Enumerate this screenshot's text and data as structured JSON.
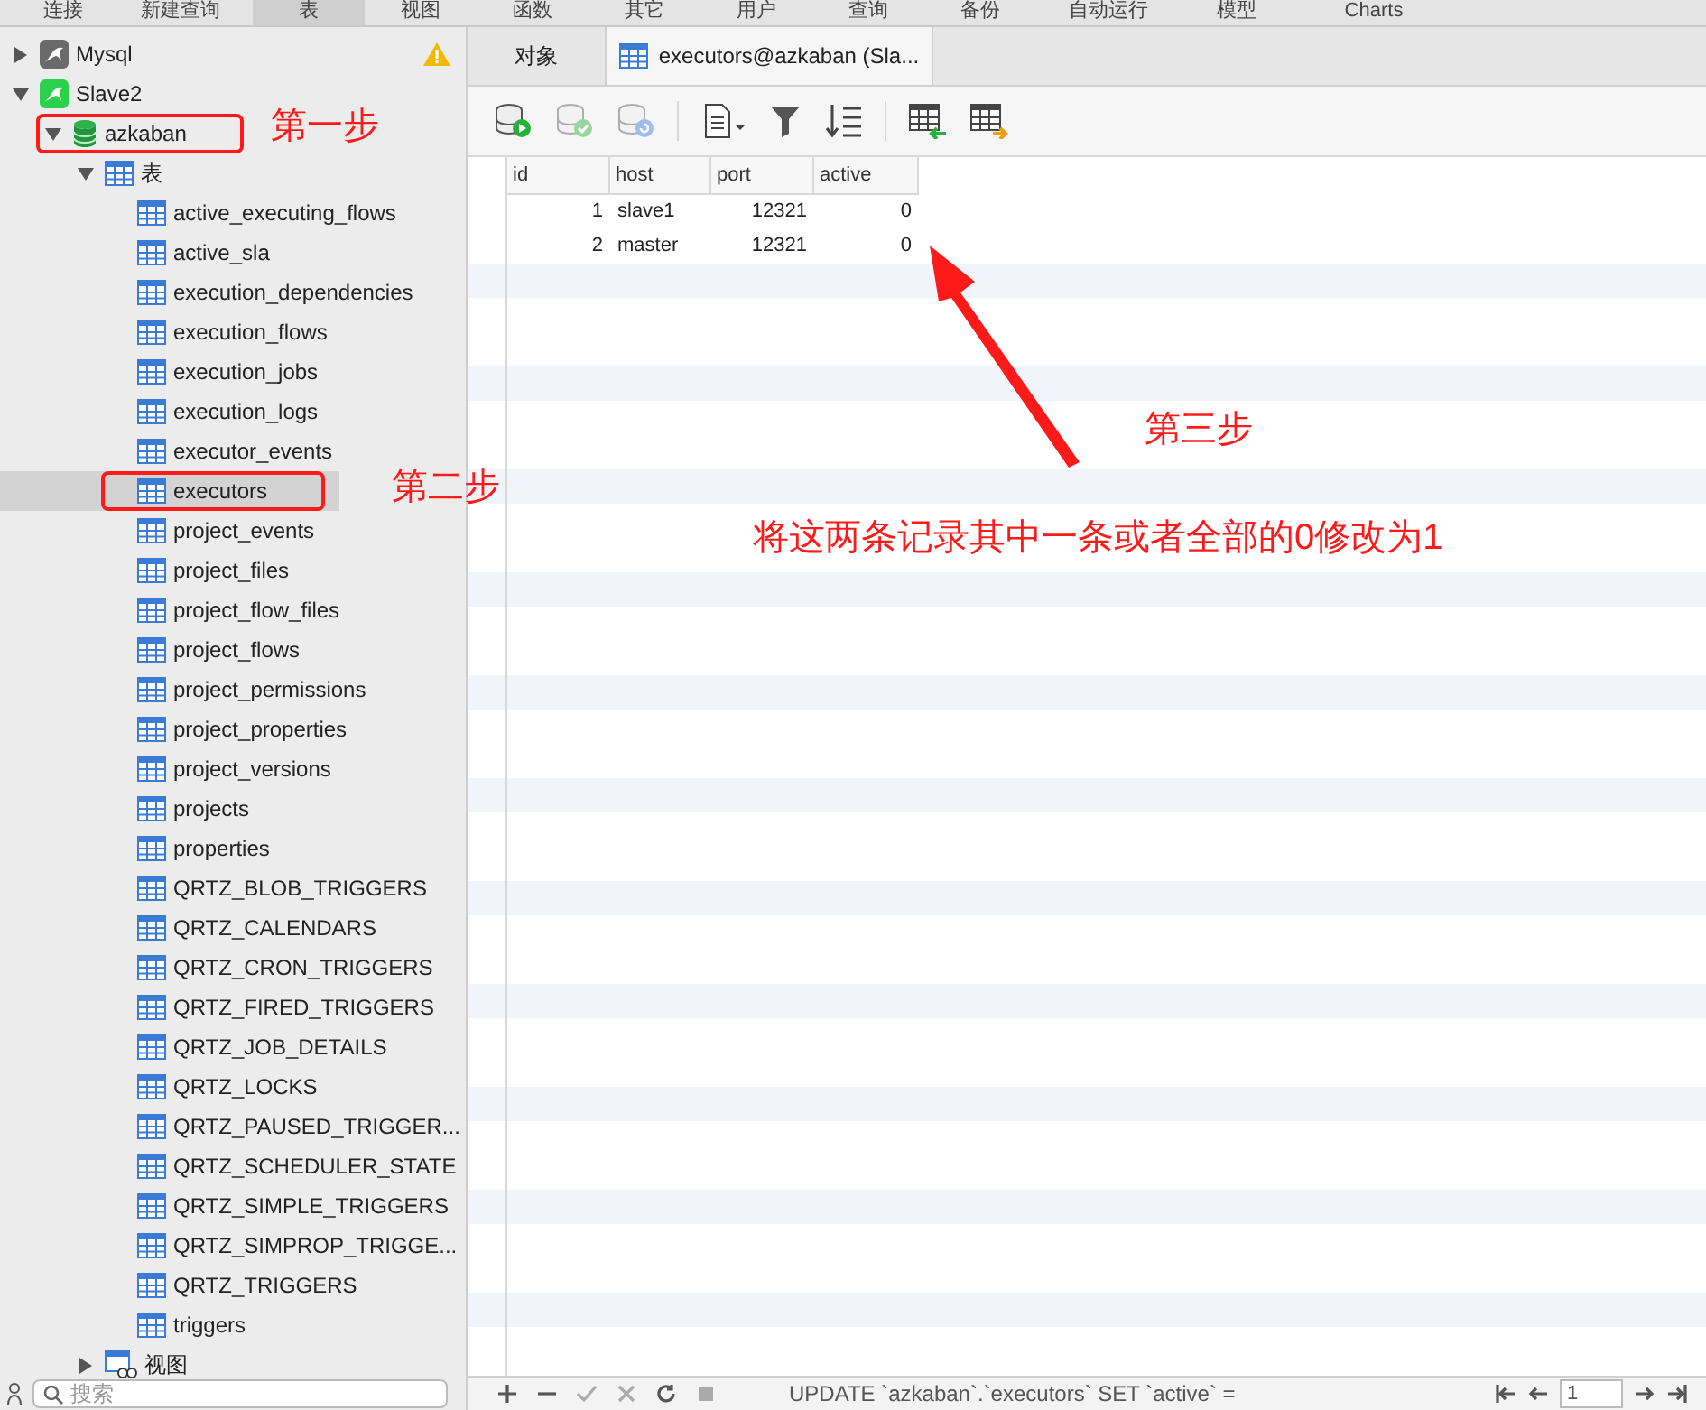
{
  "menu_bar": [
    {
      "label": "连接",
      "selected": false
    },
    {
      "label": "新建查询",
      "selected": false
    },
    {
      "label": "表",
      "selected": true
    },
    {
      "label": "视图",
      "selected": false
    },
    {
      "label": "函数",
      "selected": false
    },
    {
      "label": "其它",
      "selected": false
    },
    {
      "label": "用户",
      "selected": false
    },
    {
      "label": "查询",
      "selected": false
    },
    {
      "label": "备份",
      "selected": false
    },
    {
      "label": "自动运行",
      "selected": false
    },
    {
      "label": "模型",
      "selected": false
    },
    {
      "label": "Charts",
      "selected": false
    }
  ],
  "sidebar": {
    "tree": [
      {
        "kind": "connection",
        "name": "Mysql",
        "warning": true,
        "expanded": false,
        "selected": false,
        "circled": false
      },
      {
        "kind": "connection",
        "name": "Slave2",
        "warning": false,
        "expanded": true,
        "selected": false,
        "circled": false,
        "children": [
          {
            "kind": "database",
            "name": "azkaban",
            "expanded": true,
            "selected": false,
            "circled": true,
            "children": [
              {
                "kind": "tables",
                "name": "表",
                "expanded": true,
                "selected": false,
                "circled": false,
                "children": [
                  {
                    "kind": "table",
                    "name": "active_executing_flows",
                    "selected": false,
                    "circled": false
                  },
                  {
                    "kind": "table",
                    "name": "active_sla",
                    "selected": false,
                    "circled": false
                  },
                  {
                    "kind": "table",
                    "name": "execution_dependencies",
                    "selected": false,
                    "circled": false
                  },
                  {
                    "kind": "table",
                    "name": "execution_flows",
                    "selected": false,
                    "circled": false
                  },
                  {
                    "kind": "table",
                    "name": "execution_jobs",
                    "selected": false,
                    "circled": false
                  },
                  {
                    "kind": "table",
                    "name": "execution_logs",
                    "selected": false,
                    "circled": false
                  },
                  {
                    "kind": "table",
                    "name": "executor_events",
                    "selected": false,
                    "circled": false
                  },
                  {
                    "kind": "table",
                    "name": "executors",
                    "selected": true,
                    "circled": true
                  },
                  {
                    "kind": "table",
                    "name": "project_events",
                    "selected": false,
                    "circled": false
                  },
                  {
                    "kind": "table",
                    "name": "project_files",
                    "selected": false,
                    "circled": false
                  },
                  {
                    "kind": "table",
                    "name": "project_flow_files",
                    "selected": false,
                    "circled": false
                  },
                  {
                    "kind": "table",
                    "name": "project_flows",
                    "selected": false,
                    "circled": false
                  },
                  {
                    "kind": "table",
                    "name": "project_permissions",
                    "selected": false,
                    "circled": false
                  },
                  {
                    "kind": "table",
                    "name": "project_properties",
                    "selected": false,
                    "circled": false
                  },
                  {
                    "kind": "table",
                    "name": "project_versions",
                    "selected": false,
                    "circled": false
                  },
                  {
                    "kind": "table",
                    "name": "projects",
                    "selected": false,
                    "circled": false
                  },
                  {
                    "kind": "table",
                    "name": "properties",
                    "selected": false,
                    "circled": false
                  },
                  {
                    "kind": "table",
                    "name": "QRTZ_BLOB_TRIGGERS",
                    "selected": false,
                    "circled": false
                  },
                  {
                    "kind": "table",
                    "name": "QRTZ_CALENDARS",
                    "selected": false,
                    "circled": false
                  },
                  {
                    "kind": "table",
                    "name": "QRTZ_CRON_TRIGGERS",
                    "selected": false,
                    "circled": false
                  },
                  {
                    "kind": "table",
                    "name": "QRTZ_FIRED_TRIGGERS",
                    "selected": false,
                    "circled": false
                  },
                  {
                    "kind": "table",
                    "name": "QRTZ_JOB_DETAILS",
                    "selected": false,
                    "circled": false
                  },
                  {
                    "kind": "table",
                    "name": "QRTZ_LOCKS",
                    "selected": false,
                    "circled": false
                  },
                  {
                    "kind": "table",
                    "name": "QRTZ_PAUSED_TRIGGER...",
                    "selected": false,
                    "circled": false
                  },
                  {
                    "kind": "table",
                    "name": "QRTZ_SCHEDULER_STATE",
                    "selected": false,
                    "circled": false
                  },
                  {
                    "kind": "table",
                    "name": "QRTZ_SIMPLE_TRIGGERS",
                    "selected": false,
                    "circled": false
                  },
                  {
                    "kind": "table",
                    "name": "QRTZ_SIMPROP_TRIGGE...",
                    "selected": false,
                    "circled": false
                  },
                  {
                    "kind": "table",
                    "name": "QRTZ_TRIGGERS",
                    "selected": false,
                    "circled": false
                  },
                  {
                    "kind": "table",
                    "name": "triggers",
                    "selected": false,
                    "circled": false
                  }
                ]
              },
              {
                "kind": "views",
                "name": "视图",
                "expanded": false,
                "selected": false,
                "circled": false
              }
            ]
          }
        ]
      }
    ],
    "search": {
      "placeholder": "搜索"
    }
  },
  "tabs": [
    {
      "label": "对象",
      "selected": false
    },
    {
      "label": "executors@azkaban (Sla...",
      "selected": true
    }
  ],
  "toolbar": [
    {
      "kind": "begin",
      "disabled": false
    },
    {
      "kind": "commit",
      "disabled": true
    },
    {
      "kind": "rollback",
      "disabled": true
    },
    {
      "kind": "text",
      "disabled": false
    },
    {
      "kind": "filter",
      "disabled": false
    },
    {
      "kind": "sort",
      "disabled": false
    },
    {
      "kind": "import",
      "disabled": false
    },
    {
      "kind": "export",
      "disabled": false
    }
  ],
  "table": {
    "columns": [
      "id",
      "host",
      "port",
      "active"
    ],
    "rows": [
      [
        "1",
        "slave1",
        "12321",
        "0"
      ],
      [
        "2",
        "master",
        "12321",
        "0"
      ]
    ]
  },
  "status_bar": {
    "sql": "UPDATE `azkaban`.`executors` SET `active` =",
    "page": "1"
  },
  "annotations": {
    "step_1": "第一步",
    "step_2": "第二步",
    "step_3": "第三步",
    "note": "将这两条记录其中一条或者全部的0修改为1"
  }
}
